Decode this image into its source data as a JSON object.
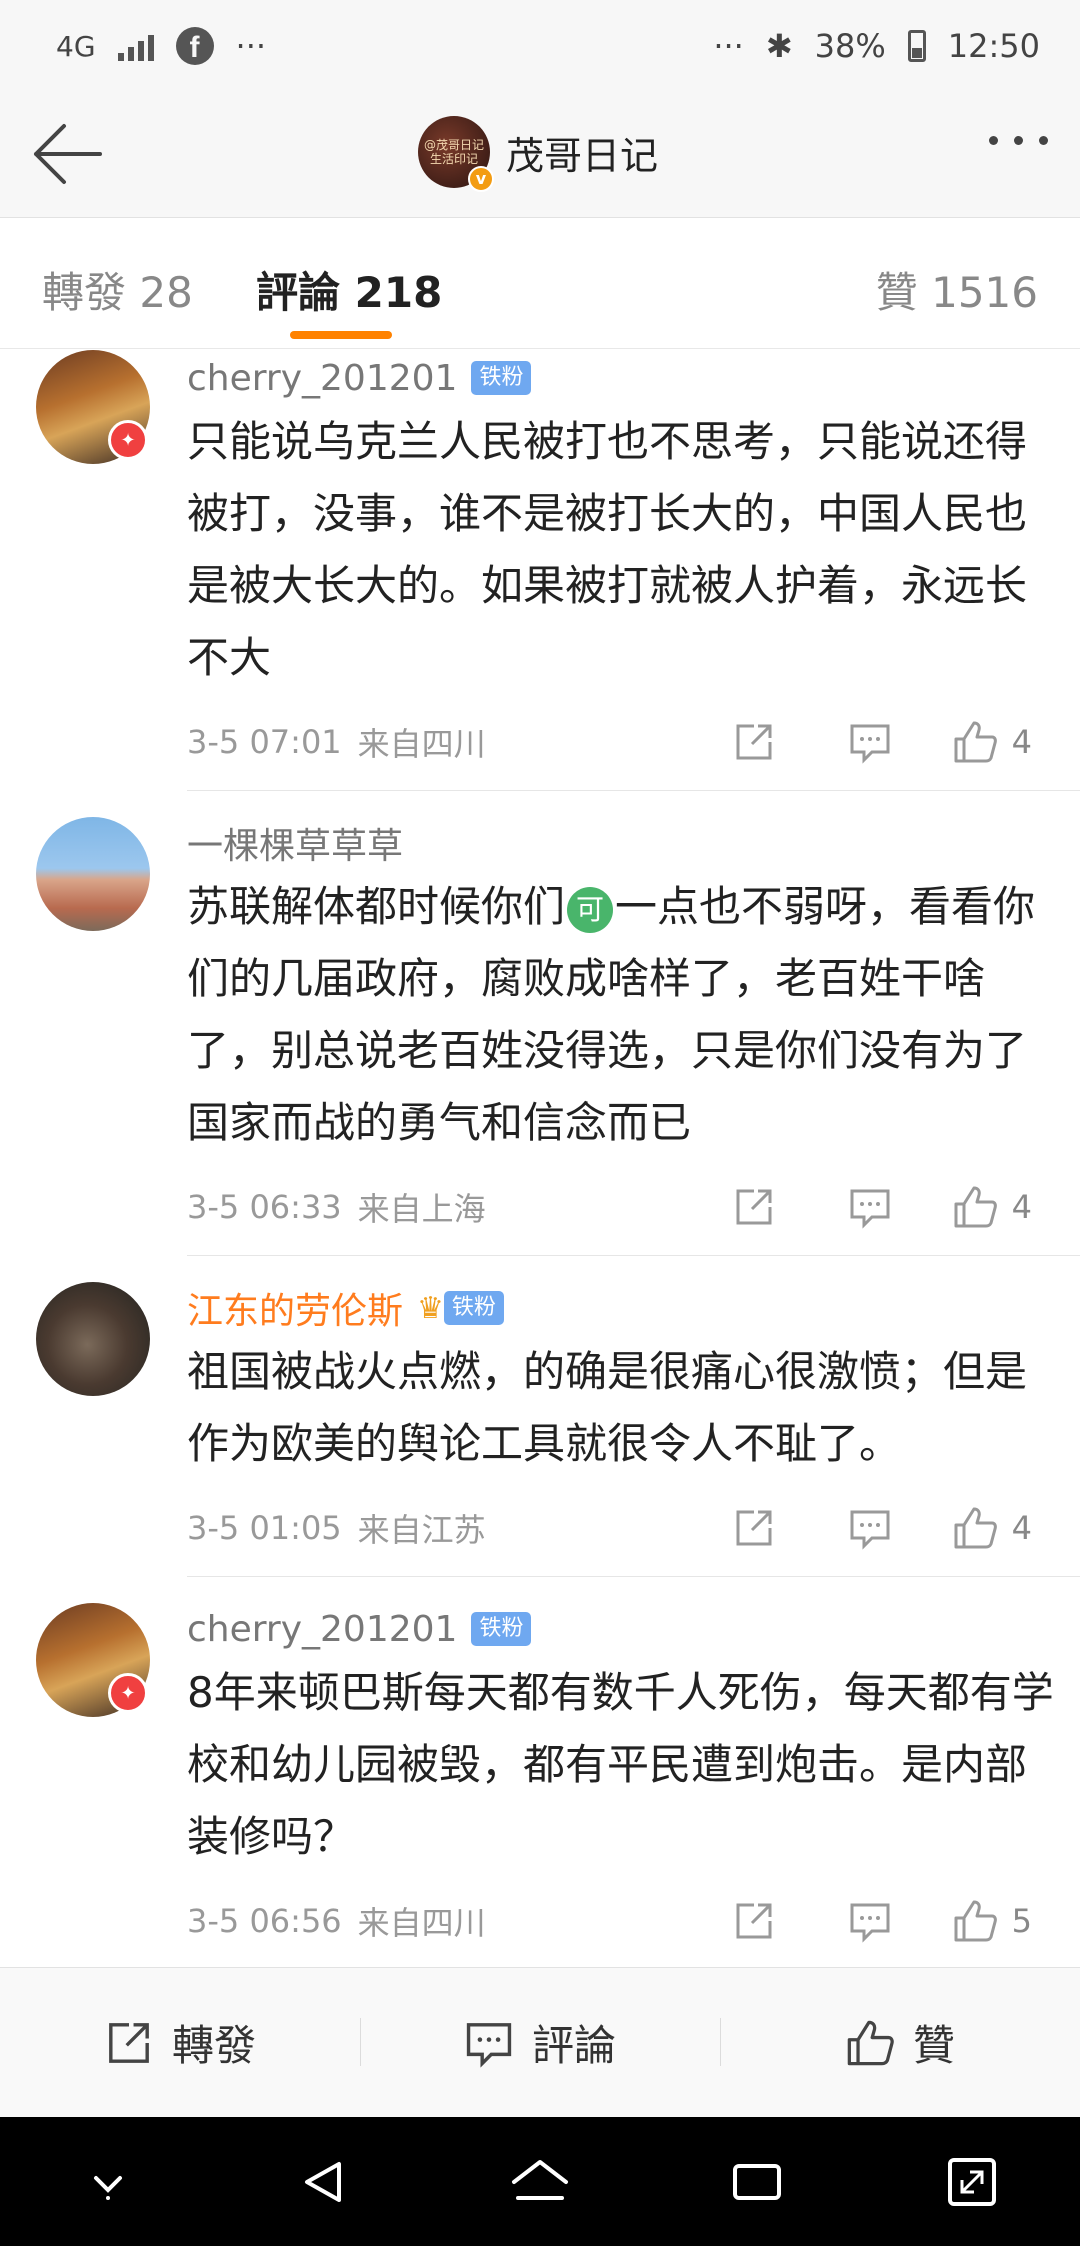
{
  "status_bar": {
    "network": "4G",
    "dots_left": "···",
    "dots_right": "···",
    "battery_percent": "38%",
    "time": "12:50"
  },
  "header": {
    "account_name": "茂哥日记",
    "avatar_text": "@茂哥日记 生活印记"
  },
  "tabs": {
    "repost": "轉發 28",
    "comment": "評論 218",
    "like": "贊 1516"
  },
  "comments": [
    {
      "user": "cherry_201201",
      "badge": "铁粉",
      "vip": false,
      "text": "只能说乌克兰人民被打也不思考，只能说还得被打，没事，谁不是被打长大的，中国人民也是被大长大的。如果被打就被人护着，永远长不大",
      "time": "3-5 07:01",
      "location": "来自四川",
      "likes": "4"
    },
    {
      "user": "一棵棵草草草",
      "badge": "",
      "vip": false,
      "text_before": "苏联解体都时候你们",
      "emoji": "可",
      "text_after": "一点也不弱呀，看看你们的几届政府，腐败成啥样了，老百姓干啥了，别总说老百姓没得选，只是你们没有为了国家而战的勇气和信念而已",
      "time": "3-5 06:33",
      "location": "来自上海",
      "likes": "4"
    },
    {
      "user": "江东的劳伦斯",
      "badge": "铁粉",
      "vip": true,
      "text": "祖国被战火点燃，的确是很痛心很激愤；但是作为欧美的舆论工具就很令人不耻了。",
      "time": "3-5 01:05",
      "location": "来自江苏",
      "likes": "4"
    },
    {
      "user": "cherry_201201",
      "badge": "铁粉",
      "vip": false,
      "text": "8年来顿巴斯每天都有数千人死伤，每天都有学校和幼儿园被毁，都有平民遭到炮击。是内部装修吗？",
      "time": "3-5 06:56",
      "location": "来自四川",
      "likes": "5"
    }
  ],
  "bottom_bar": {
    "repost": "轉發",
    "comment": "評論",
    "like": "贊"
  },
  "colors": {
    "accent": "#ff8200",
    "vip_name": "#ff7c1e",
    "fan_badge": "#6fa8f0"
  }
}
